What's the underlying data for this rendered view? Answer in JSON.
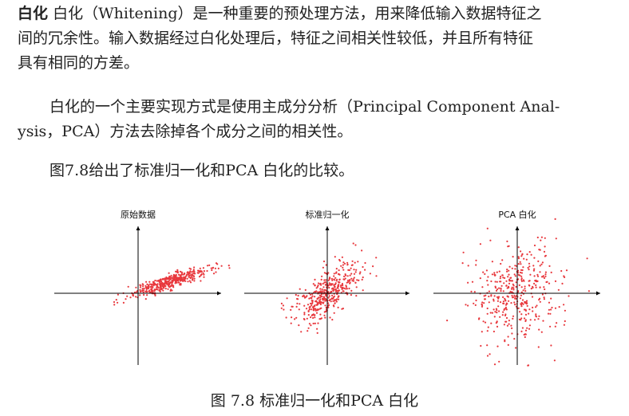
{
  "paragraph1": {
    "term": "白化",
    "term_note": "白化",
    "line1_rest": "（Whitening）是一种重要的预处理方法，用来降低输入数据特征之",
    "line2": "间的冗余性。输入数据经过白化处理后，特征之间相关性较低，并且所有特征",
    "line3": "具有相同的方差。"
  },
  "paragraph2": {
    "line1_before": "白化的一个主要实现方式是使用",
    "line1_term": "主成分分析",
    "line1_after": "（Principal Component Anal-",
    "line2": "ysis，PCA）方法去除掉各个成分之间的相关性。"
  },
  "paragraph3": {
    "text": "图7.8给出了标准归一化和PCA 白化的比较。"
  },
  "figure": {
    "caption": "图 7.8 标准归一化和PCA 白化",
    "point_color": "#e8383d",
    "axis_color": "#000000",
    "panels": [
      {
        "title": "原始数据"
      },
      {
        "title": "标准归一化"
      },
      {
        "title": "PCA 白化"
      }
    ]
  }
}
